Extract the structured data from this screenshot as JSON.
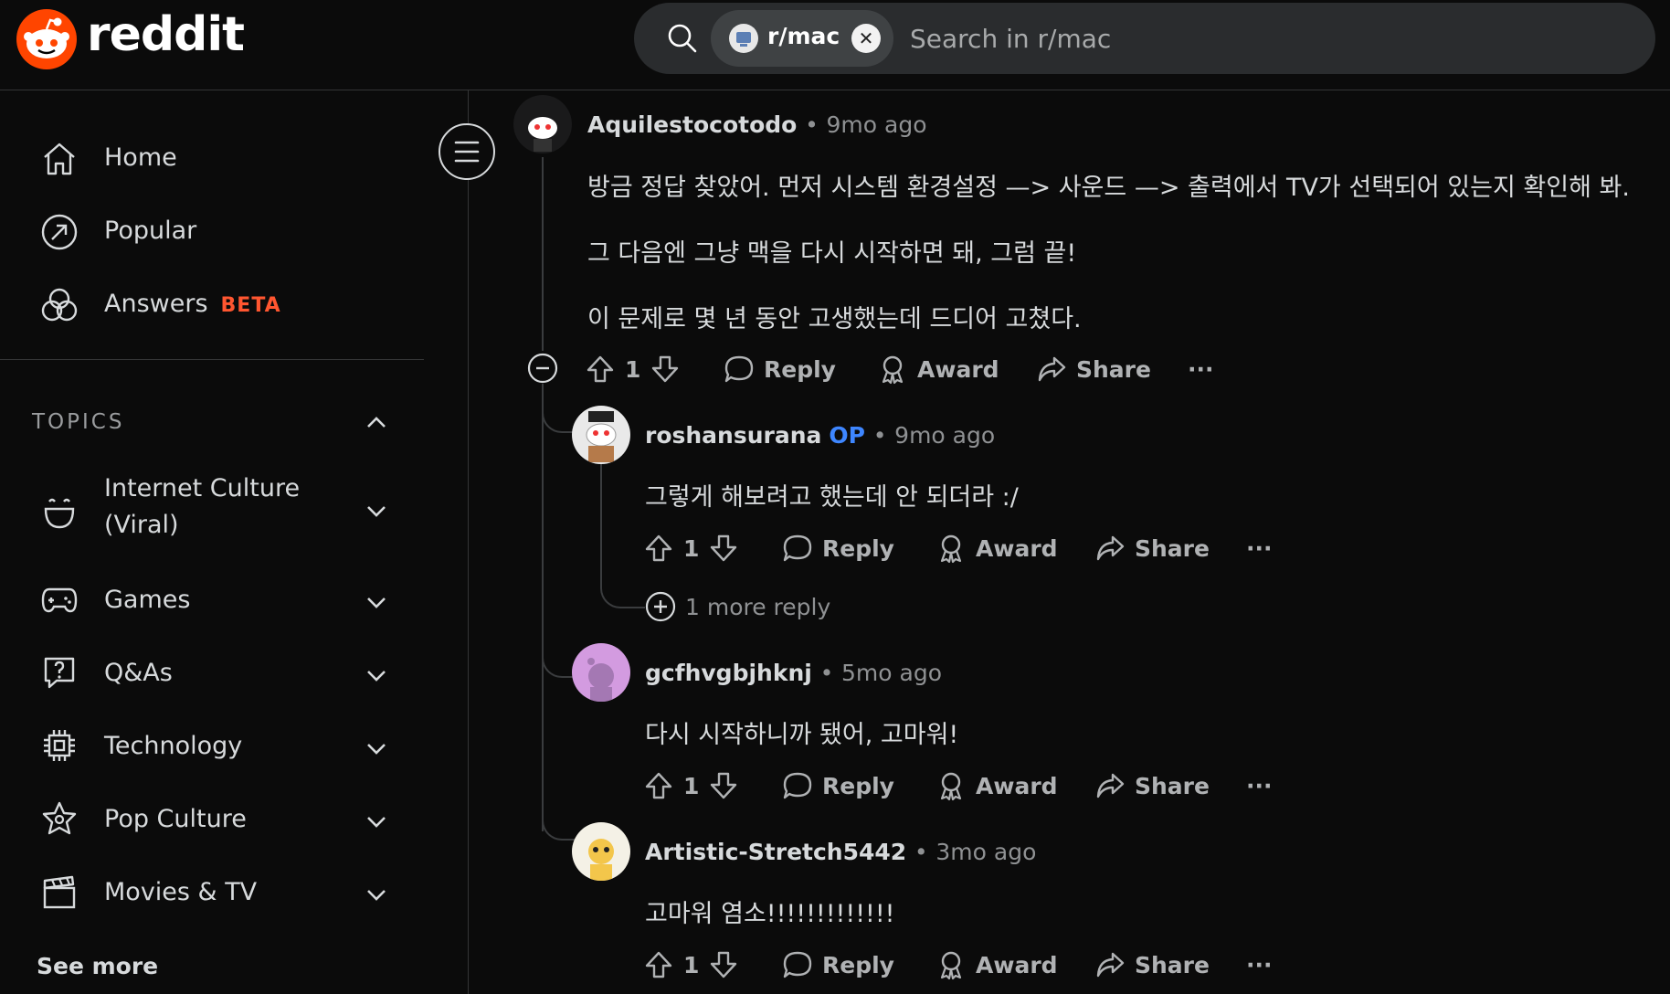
{
  "header": {
    "brand": "reddit",
    "search": {
      "chip_label": "r/mac",
      "placeholder": "Search in r/mac"
    }
  },
  "sidebar": {
    "nav": [
      {
        "label": "Home",
        "icon": "home-icon"
      },
      {
        "label": "Popular",
        "icon": "popular-icon"
      },
      {
        "label": "Answers",
        "badge": "BETA",
        "icon": "answers-icon"
      }
    ],
    "topics_label": "TOPICS",
    "topics": [
      {
        "label": "Internet Culture",
        "label2": "(Viral)",
        "icon": "smile-icon"
      },
      {
        "label": "Games",
        "icon": "gamepad-icon"
      },
      {
        "label": "Q&As",
        "icon": "question-bubble-icon"
      },
      {
        "label": "Technology",
        "icon": "chip-icon"
      },
      {
        "label": "Pop Culture",
        "icon": "star-icon"
      },
      {
        "label": "Movies & TV",
        "icon": "clapperboard-icon"
      }
    ],
    "see_more": "See more"
  },
  "comments": [
    {
      "user": "Aquilestocotodo",
      "time": "9mo ago",
      "lines": [
        "방금 정답 찾았어. 먼저 시스템 환경설정 —> 사운드 —> 출력에서 TV가 선택되어 있는지 확인해 봐.",
        "그 다음엔 그냥 맥을 다시 시작하면 돼, 그럼 끝!",
        "이 문제로 몇 년 동안 고생했는데 드디어 고쳤다."
      ],
      "votes": "1",
      "avatar_color": "#1a1a1b"
    },
    {
      "user": "roshansurana",
      "op": "OP",
      "time": "9mo ago",
      "lines": [
        "그렇게 해보려고 했는데 안 되더라 :/"
      ],
      "votes": "1",
      "more_replies": "1 more reply",
      "avatar_color": "#e9e9e9"
    },
    {
      "user": "gcfhvgbjhknj",
      "time": "5mo ago",
      "lines": [
        "다시 시작하니까 됐어, 고마워!"
      ],
      "votes": "1",
      "avatar_color": "#d39be0"
    },
    {
      "user": "Artistic-Stretch5442",
      "time": "3mo ago",
      "lines": [
        "고마워 염소!!!!!!!!!!!!!"
      ],
      "votes": "1",
      "avatar_color": "#f4f1e6"
    }
  ],
  "actions": {
    "reply": "Reply",
    "award": "Award",
    "share": "Share",
    "more": "···"
  },
  "sep": "•"
}
